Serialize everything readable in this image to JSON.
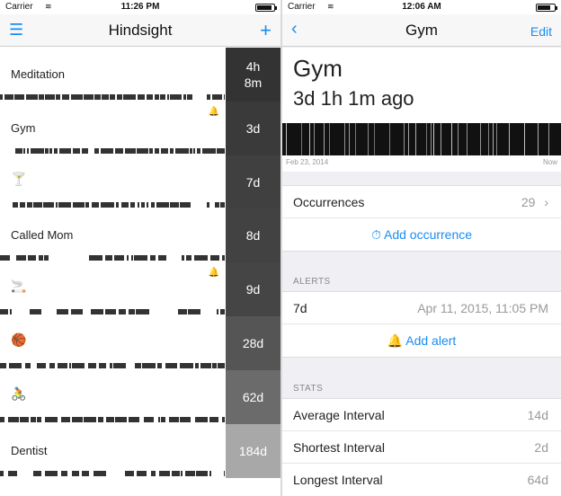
{
  "left": {
    "status": {
      "carrier": "Carrier",
      "time": "11:26 PM"
    },
    "nav": {
      "title": "Hindsight",
      "add_label": "+"
    },
    "rows": [
      {
        "label": "Meditation",
        "emoji": "",
        "bell": false,
        "badge": "4h\n8m",
        "badge_color": "#333333"
      },
      {
        "label": "Gym",
        "emoji": "",
        "bell": true,
        "badge": "3d",
        "badge_color": "#3a3a3a"
      },
      {
        "label": "",
        "emoji": "🍸",
        "bell": false,
        "badge": "7d",
        "badge_color": "#404040"
      },
      {
        "label": "Called Mom",
        "emoji": "",
        "bell": false,
        "badge": "8d",
        "badge_color": "#424242"
      },
      {
        "label": "",
        "emoji": "🚬",
        "bell": true,
        "badge": "9d",
        "badge_color": "#454545"
      },
      {
        "label": "",
        "emoji": "🏀",
        "bell": false,
        "badge": "28d",
        "badge_color": "#555555"
      },
      {
        "label": "",
        "emoji": "🚴",
        "bell": false,
        "badge": "62d",
        "badge_color": "#6b6b6b"
      },
      {
        "label": "Dentist",
        "emoji": "",
        "bell": false,
        "badge": "184d",
        "badge_color": "#a8a8a8"
      }
    ]
  },
  "right": {
    "status": {
      "carrier": "Carrier",
      "time": "12:06 AM"
    },
    "nav": {
      "title": "Gym",
      "edit_label": "Edit"
    },
    "title": "Gym",
    "since": "3d 1h 1m ago",
    "axis_start": "Feb 23, 2014",
    "axis_end": "Now",
    "occurrences_label": "Occurrences",
    "occurrences_count": "29",
    "add_occurrence": "Add occurrence",
    "alerts_section": "ALERTS",
    "alert_value": "7d",
    "alert_date": "Apr 11, 2015, 11:05 PM",
    "add_alert": "Add alert",
    "stats_section": "STATS",
    "stats": [
      {
        "label": "Average Interval",
        "value": "14d"
      },
      {
        "label": "Shortest Interval",
        "value": "2d"
      },
      {
        "label": "Longest Interval",
        "value": "64d"
      }
    ]
  }
}
